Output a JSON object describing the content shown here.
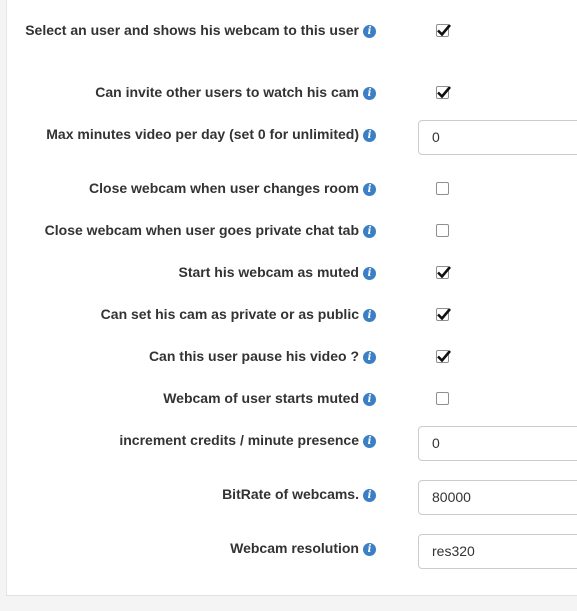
{
  "settings": {
    "select_user_webcam": {
      "label": "Select an user and shows his webcam to this user",
      "checked": true,
      "icon": "info-icon"
    },
    "invite_users": {
      "label": "Can invite other users to watch his cam",
      "checked": true,
      "icon": "info-icon"
    },
    "max_minutes": {
      "label": "Max minutes video per day (set 0 for unlimited)",
      "value": "0",
      "icon": "info-icon"
    },
    "close_change_room": {
      "label": "Close webcam when user changes room",
      "checked": false,
      "icon": "info-icon"
    },
    "close_private_chat": {
      "label": "Close webcam when user goes private chat tab",
      "checked": false,
      "icon": "info-icon"
    },
    "start_muted": {
      "label": "Start his webcam as muted",
      "checked": true,
      "icon": "info-icon"
    },
    "private_public": {
      "label": "Can set his cam as private or as public",
      "checked": true,
      "icon": "info-icon"
    },
    "pause_video": {
      "label": "Can this user pause his video ?",
      "checked": true,
      "icon": "info-icon"
    },
    "webcam_starts_muted": {
      "label": "Webcam of user starts muted",
      "checked": false,
      "icon": "info-icon"
    },
    "increment_credits": {
      "label": "increment credits / minute presence",
      "value": "0",
      "icon": "info-icon"
    },
    "bitrate": {
      "label": "BitRate of webcams.",
      "value": "80000",
      "icon": "info-icon"
    },
    "resolution": {
      "label": "Webcam resolution",
      "value": "res320",
      "icon": "info-icon"
    }
  },
  "colors": {
    "info_icon": "#3c7fc4",
    "label_text": "#333333",
    "checkmark": "#111111"
  }
}
